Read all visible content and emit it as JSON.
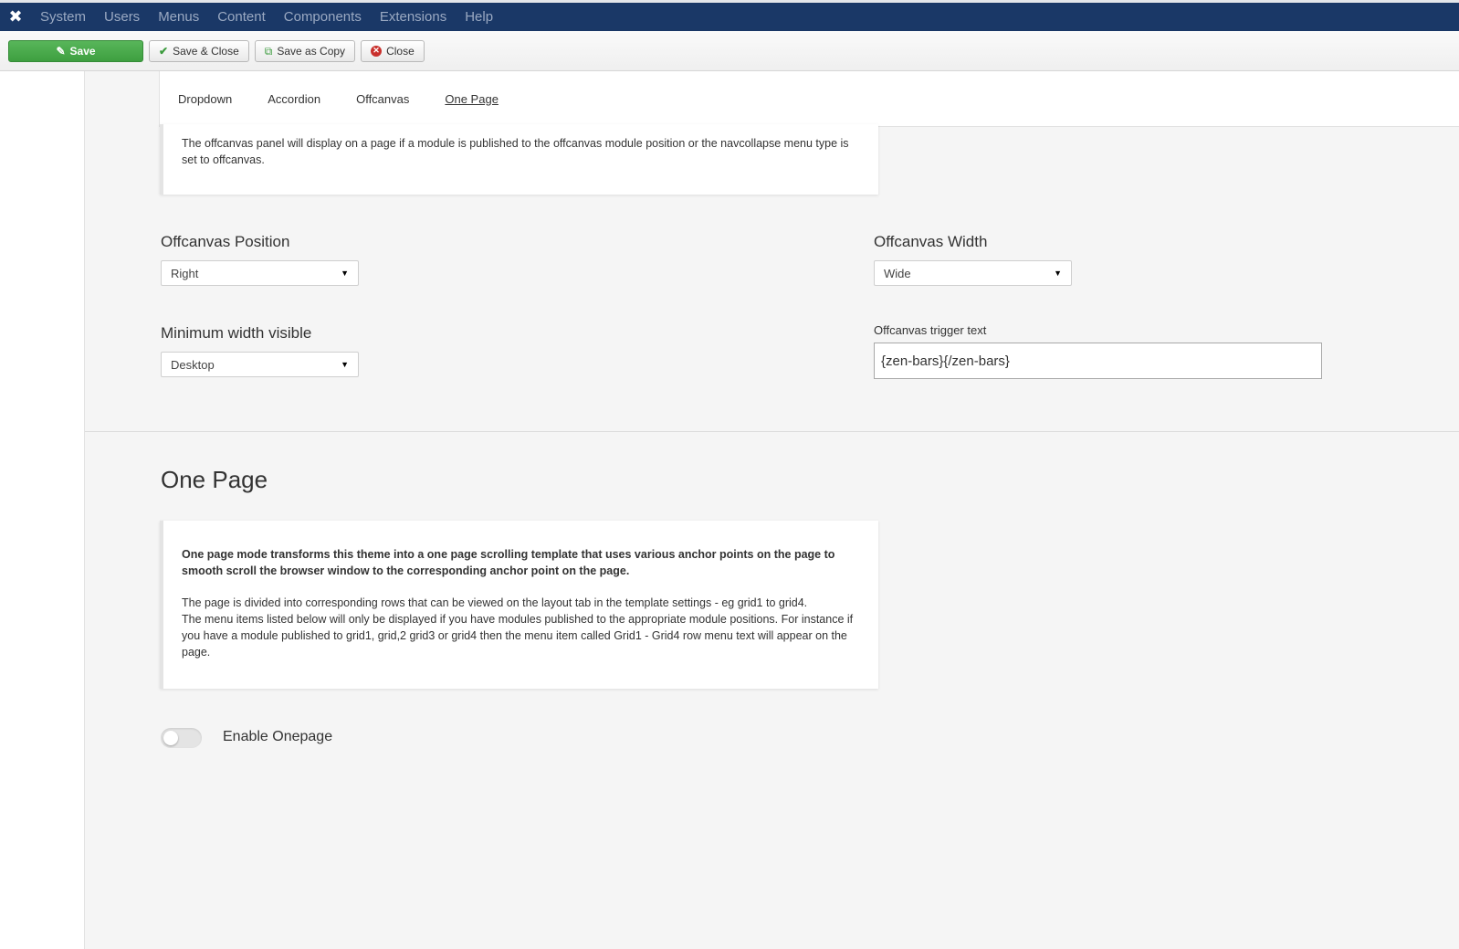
{
  "topnav": {
    "logo_icon": "joomla-logo-icon",
    "items": [
      "System",
      "Users",
      "Menus",
      "Content",
      "Components",
      "Extensions",
      "Help"
    ]
  },
  "toolbar": {
    "save_label": "Save",
    "save_close_label": "Save & Close",
    "save_copy_label": "Save as Copy",
    "close_label": "Close",
    "accent": "#4aa94c"
  },
  "tabs": [
    "Dropdown",
    "Accordion",
    "Offcanvas",
    "One Page"
  ],
  "active_tab": "One Page",
  "offcanvas": {
    "info": "The offcanvas panel will display on a page if a module is published to the offcanvas module position or the navcollapse menu type is set to offcanvas.",
    "position_label": "Offcanvas Position",
    "position_value": "Right",
    "width_label": "Offcanvas Width",
    "width_value": "Wide",
    "min_width_label": "Minimum width visible",
    "min_width_value": "Desktop",
    "trigger_label": "Offcanvas trigger text",
    "trigger_value": "{zen-bars}{/zen-bars}"
  },
  "onepage": {
    "title": "One Page",
    "lead": "One page mode transforms this theme into a one page scrolling template that uses various anchor points on the page to smooth scroll the browser window to the corresponding anchor point on the page.",
    "para1": "The page is divided into corresponding rows that can be viewed on the layout tab in the template settings - eg grid1 to grid4.",
    "para2": "The menu items listed below will only be displayed if you have modules published to the appropriate module positions. For instance if you have a module published to grid1, grid,2 grid3 or grid4 then the menu item called Grid1 - Grid4 row menu text will appear on the page.",
    "toggle_label": "Enable Onepage",
    "toggle_enabled": false
  }
}
